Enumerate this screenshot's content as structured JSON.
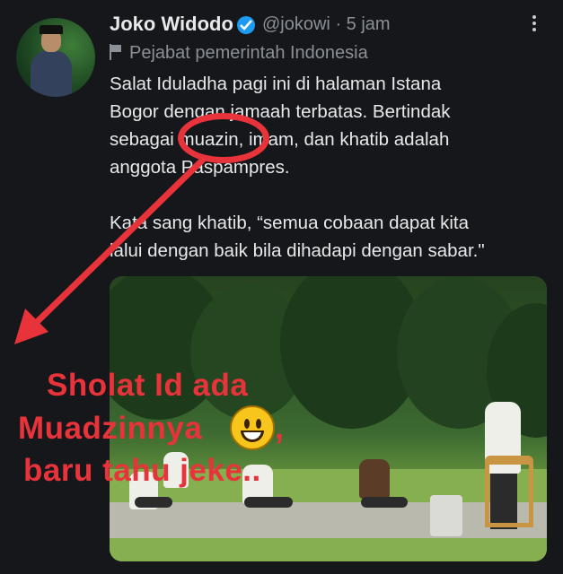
{
  "author": {
    "name": "Joko Widodo",
    "handle": "@jokowi",
    "time": "· 5 jam",
    "label": "Pejabat pemerintah Indonesia",
    "avatar_icon": "profile-photo",
    "verified_icon": "verified-badge-icon"
  },
  "tweet": {
    "lines": [
      "Salat Iduladha pagi ini di halaman Istana",
      "Bogor dengan jamaah terbatas. Bertindak",
      "sebagai muazin, imam, dan khatib adalah",
      "anggota Paspampres.",
      "Kata sang khatib, “semua cobaan dapat kita",
      "lalui dengan baik bila dihadapi dengan sabar.\""
    ]
  },
  "overlay": {
    "line1": "Sholat Id ada",
    "line2": "Muadzinnya",
    "line2_suffix": ",",
    "line3": "baru tahu jeke..",
    "emoji": "grinning-face-emoji",
    "accent_color": "#e8333b"
  }
}
